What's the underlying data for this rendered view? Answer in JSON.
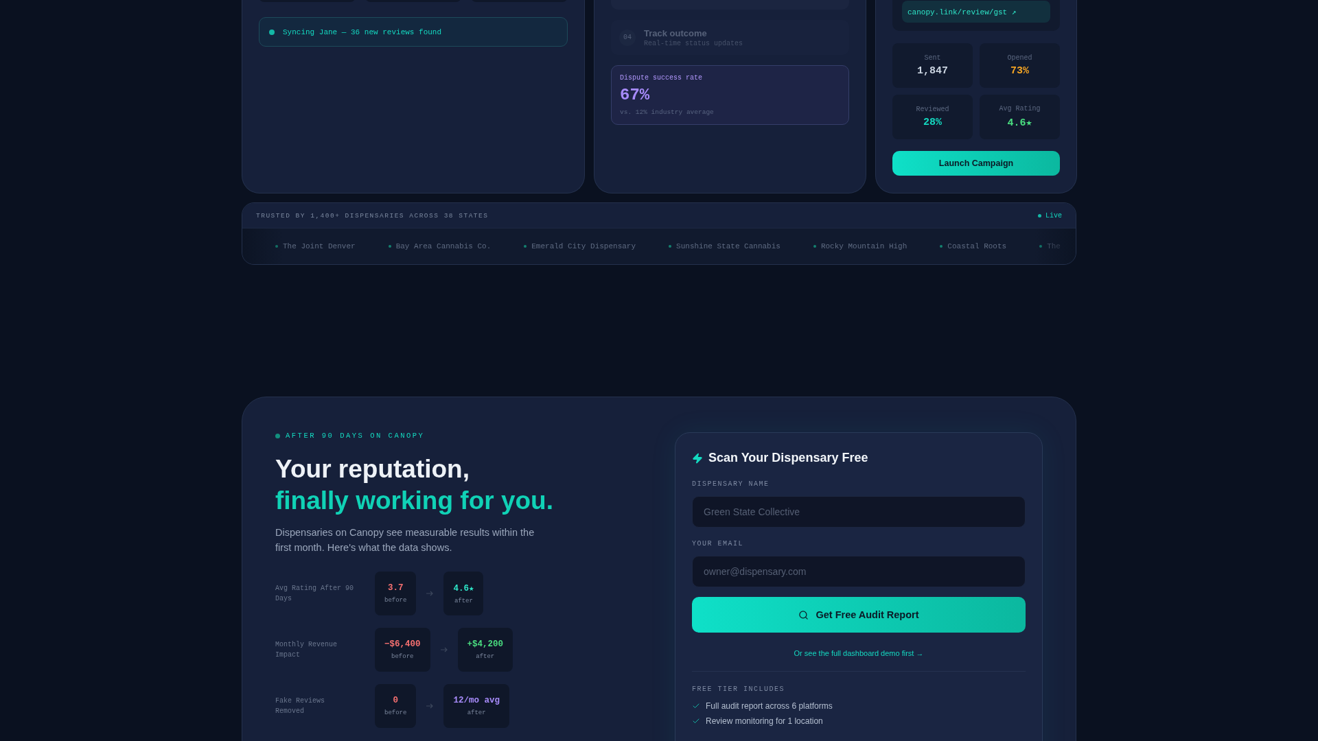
{
  "integrations_card": {
    "sync_status": "Syncing Jane — 36 new reviews found"
  },
  "dispute_card": {
    "steps": [
      {
        "number": "04",
        "title": "Track outcome",
        "subtitle": "Real-time status updates",
        "active": false
      }
    ],
    "success": {
      "label": "Dispute success rate",
      "value": "67%",
      "note": "vs. 12% industry average"
    }
  },
  "campaign_card": {
    "link": "canopy.link/review/gst ↗",
    "stats": [
      {
        "label": "Sent",
        "value": "1,847",
        "color": "#cbd5e1"
      },
      {
        "label": "Opened",
        "value": "73%",
        "color": "#f5a524"
      },
      {
        "label": "Reviewed",
        "value": "28%",
        "color": "#14d9c0"
      },
      {
        "label": "Avg Rating",
        "value": "4.6★",
        "color": "#4ade80"
      }
    ],
    "button": "Launch Campaign"
  },
  "trusted_bar": {
    "heading": "TRUSTED BY 1,400+ DISPENSARIES ACROSS 38 STATES",
    "live": "Live",
    "items": [
      "The Joint Denver",
      "Bay Area Cannabis Co.",
      "Emerald City Dispensary",
      "Sunshine State Cannabis",
      "Rocky Mountain High",
      "Coastal Roots",
      "The"
    ]
  },
  "results": {
    "tag": "AFTER 90 DAYS ON CANOPY",
    "heading": "Your reputation,",
    "heading_accent": "finally working for you.",
    "intro": "Dispensaries on Canopy see measurable results within the first month. Here's what the data shows.",
    "metrics": [
      {
        "label": "Avg Rating After 90 Days",
        "before": "3.7",
        "before_label": "before",
        "after": "4.6★",
        "after_label": "after",
        "color": "#2ee6c8"
      },
      {
        "label": "Monthly Revenue Impact",
        "before": "−$6,400",
        "before_label": "before",
        "after": "+$4,200",
        "after_label": "after",
        "color": "#4ade80"
      },
      {
        "label": "Fake Reviews Removed",
        "before": "0",
        "before_label": "before",
        "after": "12/mo avg",
        "after_label": "after",
        "color": "#a78bfa"
      }
    ]
  },
  "scan_form": {
    "title": "Scan Your Dispensary Free",
    "fields": [
      {
        "label": "DISPENSARY NAME",
        "placeholder": "Green State Collective"
      },
      {
        "label": "YOUR EMAIL",
        "placeholder": "owner@dispensary.com"
      }
    ],
    "button": "Get Free Audit Report",
    "demo_link": "Or see the full dashboard demo first →",
    "includes_heading": "FREE TIER INCLUDES",
    "includes": [
      "Full audit report across 6 platforms",
      "Review monitoring for 1 location"
    ]
  }
}
